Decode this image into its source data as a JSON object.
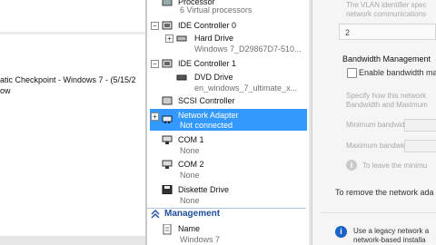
{
  "checkpoints": {
    "line1": "atic Checkpoint - Windows 7 - (5/15/2",
    "line2": "ow"
  },
  "tree": {
    "processor_label": "Processor",
    "processor_sub": "6 Virtual processors",
    "ide0_label": "IDE Controller 0",
    "hard_drive_label": "Hard Drive",
    "hard_drive_sub": "Windows 7_D29867D7-510...",
    "ide1_label": "IDE Controller 1",
    "dvd_label": "DVD Drive",
    "dvd_sub": "en_windows_7_ultimate_x...",
    "scsi_label": "SCSI Controller",
    "net_label": "Network Adapter",
    "net_sub": "Not connected",
    "com1_label": "COM 1",
    "com1_sub": "None",
    "com2_label": "COM 2",
    "com2_sub": "None",
    "diskette_label": "Diskette Drive",
    "diskette_sub": "None",
    "management_label": "Management",
    "name_label": "Name",
    "name_sub": "Windows 7"
  },
  "settings": {
    "vlan_line1": "The VLAN identifier spec",
    "vlan_line2": "network communications",
    "vlan_value": "2",
    "bw_heading": "Bandwidth Management",
    "bw_checkbox_label": "Enable bandwidth ma",
    "bw_desc1": "Specify how this network",
    "bw_desc2": "Bandwidth and Maximum",
    "min_bw_label": "Minimum bandwidth:",
    "max_bw_label": "Maximum bandwidth:",
    "leave_text": "To leave the minimu",
    "remove_text": "To remove the network ada",
    "legacy_line1": "Use a legacy network a",
    "legacy_line2": "network-based installa"
  },
  "colors": {
    "selection": "#3399ff",
    "management": "#1f4e9c",
    "info_blue": "#1a62c6"
  }
}
